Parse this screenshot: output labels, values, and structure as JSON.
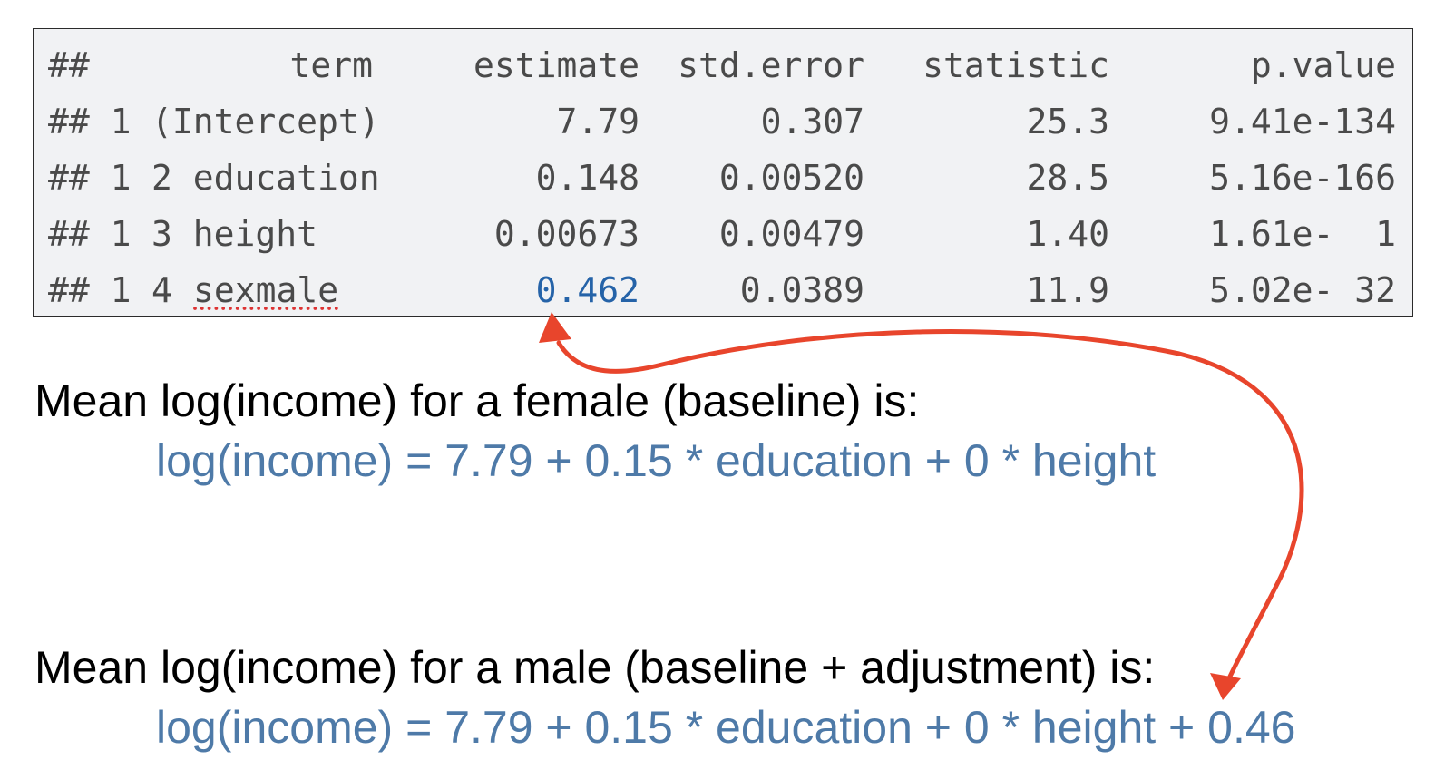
{
  "table": {
    "header": {
      "hash": "##",
      "term": "term",
      "estimate": "estimate",
      "std_error": "std.error",
      "statistic": "statistic",
      "p_value": "p.value"
    },
    "rows": [
      {
        "prefix": "## 1",
        "term": "(Intercept)",
        "estimate": "7.79",
        "std_error": "0.307",
        "statistic": "25.3",
        "p_value": "9.41e-134"
      },
      {
        "prefix": "## 1",
        "term": "2 education",
        "estimate": "0.148",
        "std_error": "0.00520",
        "statistic": "28.5",
        "p_value": "5.16e-166"
      },
      {
        "prefix": "## 1",
        "term": "3 height",
        "estimate": "0.00673",
        "std_error": "0.00479",
        "statistic": "1.40",
        "p_value": "1.61e-  1"
      },
      {
        "prefix": "## 1",
        "term": "4 sexmale",
        "term_num": "4 ",
        "term_word": "sexmale",
        "estimate": "0.462",
        "std_error": "0.0389",
        "statistic": "11.9",
        "p_value": "5.02e- 32"
      }
    ]
  },
  "female": {
    "label": "Mean log(income) for a female (baseline) is:",
    "formula": "log(income) = 7.79 + 0.15 * education + 0 * height"
  },
  "male": {
    "label": "Mean log(income) for a male (baseline + adjustment) is:",
    "formula": "log(income) = 7.79 + 0.15 * education + 0 * height + 0.46"
  },
  "colors": {
    "code_bg": "#f1f2f4",
    "code_text": "#4a4a4a",
    "highlight": "#2563a8",
    "formula": "#4e7aa8",
    "arrow": "#e8452c"
  }
}
